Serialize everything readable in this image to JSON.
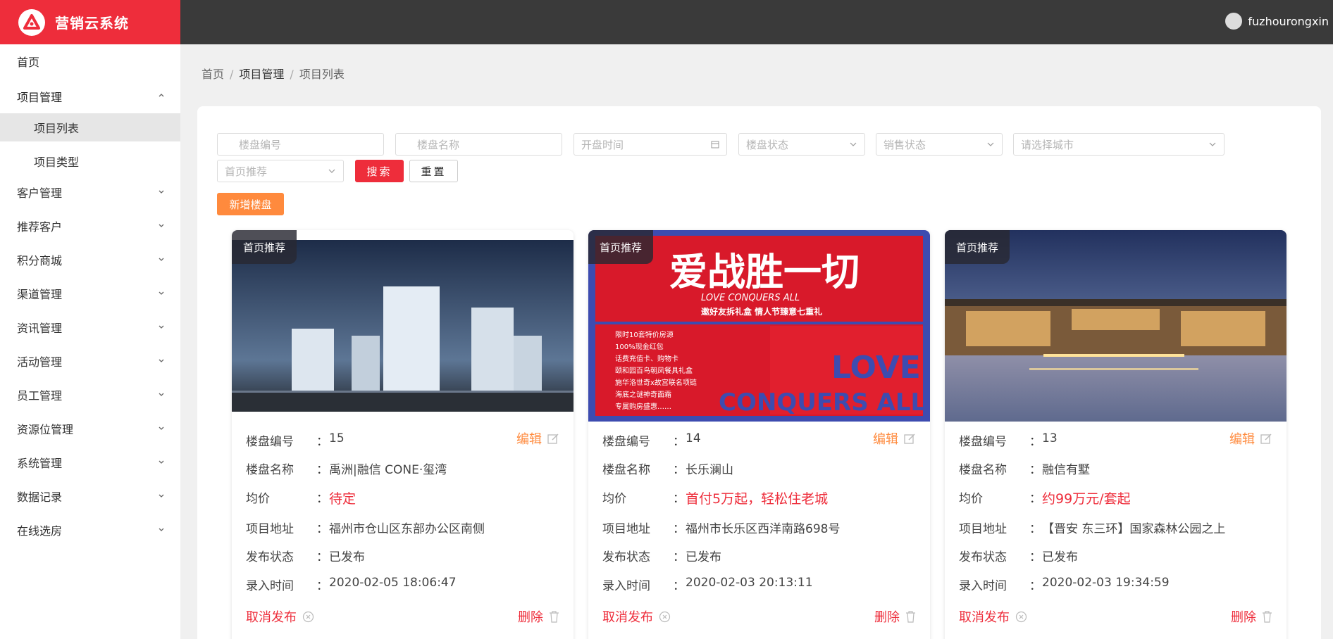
{
  "app": {
    "title": "营销云系统"
  },
  "user": {
    "name": "fuzhourongxin"
  },
  "sidebar": {
    "items": [
      {
        "label": "首页"
      },
      {
        "label": "项目管理"
      },
      {
        "label": "项目列表"
      },
      {
        "label": "项目类型"
      },
      {
        "label": "客户管理"
      },
      {
        "label": "推荐客户"
      },
      {
        "label": "积分商城"
      },
      {
        "label": "渠道管理"
      },
      {
        "label": "资讯管理"
      },
      {
        "label": "活动管理"
      },
      {
        "label": "员工管理"
      },
      {
        "label": "资源位管理"
      },
      {
        "label": "系统管理"
      },
      {
        "label": "数据记录"
      },
      {
        "label": "在线选房"
      }
    ]
  },
  "breadcrumb": {
    "home": "首页",
    "section": "项目管理",
    "page": "项目列表",
    "sep": "/"
  },
  "filters": {
    "code_placeholder": "楼盘编号",
    "name_placeholder": "楼盘名称",
    "date_placeholder": "开盘时间",
    "status_placeholder": "楼盘状态",
    "sale_placeholder": "销售状态",
    "city_placeholder": "请选择城市",
    "recommend_placeholder": "首页推荐",
    "search_label": "搜索",
    "reset_label": "重置",
    "add_label": "新增楼盘"
  },
  "labels": {
    "code": "楼盘编号",
    "name": "楼盘名称",
    "price": "均价",
    "address": "项目地址",
    "status": "发布状态",
    "time": "录入时间",
    "colon": "：",
    "edit": "编辑",
    "cancel": "取消发布",
    "delete": "删除",
    "tag": "首页推荐"
  },
  "cards": [
    {
      "code": "15",
      "name": "禹洲|融信 CONE·玺湾",
      "price": "待定",
      "address": "福州市仓山区东部办公区南侧",
      "status": "已发布",
      "time": "2020-02-05 18:06:47"
    },
    {
      "code": "14",
      "name": "长乐澜山",
      "price": "首付5万起，轻松住老城",
      "address": "福州市长乐区西洋南路698号",
      "status": "已发布",
      "time": "2020-02-03 20:13:11",
      "banner": {
        "headline": "爱战胜一切",
        "sub": "LOVE CONQUERS ALL",
        "slogan": "邀好友拆礼盒 情人节臻意七重礼",
        "big": "LOVE",
        "big2": "CONQUERS ALL",
        "list": [
          "限时10套特价房源",
          "100%现金红包",
          "话费充值卡、购物卡",
          "颐和园百鸟朝凤餐具礼盒",
          "施华洛世奇x故宫联名项链",
          "海底之谜神奇面霜",
          "专属购房盛惠……"
        ]
      }
    },
    {
      "code": "13",
      "name": "融信有墅",
      "price": "约99万元/套起",
      "address": "【晋安 东三环】国家森林公园之上",
      "status": "已发布",
      "time": "2020-02-03 19:34:59"
    }
  ],
  "colors": {
    "brand": "#ee2d3b",
    "topbar": "#3a3a3a",
    "accent": "#ff8a3d"
  }
}
